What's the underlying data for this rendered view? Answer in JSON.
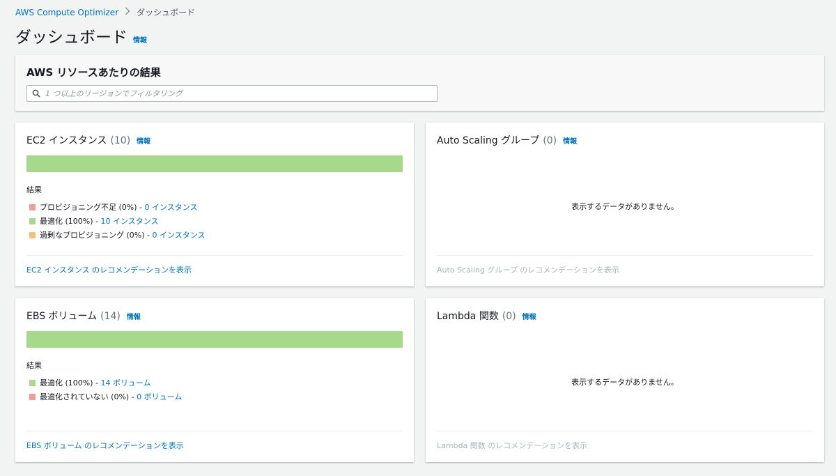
{
  "breadcrumb": {
    "service": "AWS Compute Optimizer",
    "current": "ダッシュボード"
  },
  "page": {
    "title": "ダッシュボード",
    "info": "情報"
  },
  "filter_panel": {
    "title": "AWS リソースあたりの結果",
    "search_placeholder": "1 つ以上のリージョンでフィルタリング",
    "search_icon": "search-icon"
  },
  "colors": {
    "under": "#f29d9d",
    "optimized": "#a6d98c",
    "over": "#f5bf7a",
    "link": "#0073bb"
  },
  "ec2": {
    "name": "EC2 インスタンス",
    "count": "(10)",
    "info": "情報",
    "bar": [
      {
        "key": "under",
        "fraction": 0
      },
      {
        "key": "optimized",
        "fraction": 1.0
      },
      {
        "key": "over",
        "fraction": 0
      }
    ],
    "results_label": "結果",
    "findings": [
      {
        "label": "プロビジョニング不足 (0%) - ",
        "link": "0 インスタンス",
        "color": "under"
      },
      {
        "label": "最適化 (100%) - ",
        "link": "10 インスタンス",
        "color": "optimized"
      },
      {
        "label": "過剰なプロビジョニング (0%) - ",
        "link": "0 インスタンス",
        "color": "over"
      }
    ],
    "footer": "EC2 インスタンス のレコメンデーションを表示"
  },
  "asg": {
    "name": "Auto Scaling グループ",
    "count": "(0)",
    "info": "情報",
    "empty": "表示するデータがありません。",
    "footer": "Auto Scaling グループ のレコメンデーションを表示"
  },
  "ebs": {
    "name": "EBS ボリューム",
    "count": "(14)",
    "info": "情報",
    "bar": [
      {
        "key": "optimized",
        "fraction": 1.0
      },
      {
        "key": "under",
        "fraction": 0
      }
    ],
    "results_label": "結果",
    "findings": [
      {
        "label": "最適化 (100%) - ",
        "link": "14 ボリューム",
        "color": "optimized"
      },
      {
        "label": "最適化されていない (0%) - ",
        "link": "0 ボリューム",
        "color": "under"
      }
    ],
    "footer": "EBS ボリューム のレコメンデーションを表示"
  },
  "lambda": {
    "name": "Lambda 関数",
    "count": "(0)",
    "info": "情報",
    "empty": "表示するデータがありません。",
    "footer": "Lambda 関数 のレコメンデーションを表示"
  }
}
